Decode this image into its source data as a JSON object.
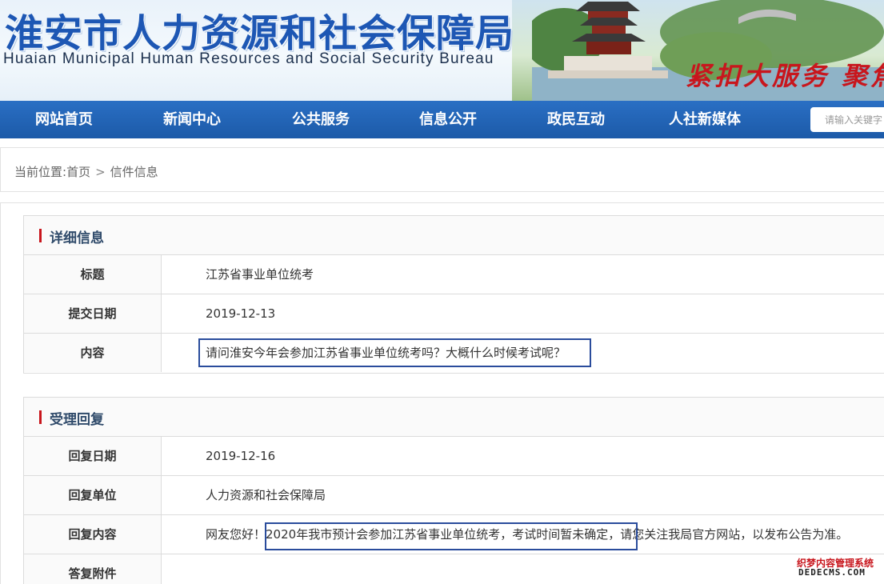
{
  "header": {
    "title_cn": "淮安市人力资源和社会保障局",
    "title_en": "Huaian Municipal Human Resources and Social Security Bureau",
    "slogan": "紧扣大服务  聚焦"
  },
  "nav": {
    "items": [
      "网站首页",
      "新闻中心",
      "公共服务",
      "信息公开",
      "政民互动",
      "人社新媒体"
    ],
    "search_placeholder": "请输入关键字"
  },
  "breadcrumb": {
    "prefix": "当前位置:",
    "home": "首页",
    "separator": ">",
    "current": "信件信息"
  },
  "detail": {
    "heading": "详细信息",
    "rows": [
      {
        "label": "标题",
        "value": "江苏省事业单位统考"
      },
      {
        "label": "提交日期",
        "value": "2019-12-13"
      },
      {
        "label": "内容",
        "value": "请问淮安今年会参加江苏省事业单位统考吗？大概什么时候考试呢？"
      }
    ]
  },
  "reply": {
    "heading": "受理回复",
    "rows": [
      {
        "label": "回复日期",
        "value": "2019-12-16"
      },
      {
        "label": "回复单位",
        "value": "人力资源和社会保障局"
      },
      {
        "label": "回复内容",
        "value_prefix": "网友您好！",
        "value_highlight": "2020年我市预计会参加江苏省事业单位统考，考试时间暂未确定",
        "value_suffix": "，请您关注我局官方网站，以发布公告为准。"
      },
      {
        "label": "答复附件",
        "value": ""
      }
    ]
  },
  "watermark": {
    "cn": "织梦内容管理系统",
    "en": "DEDECMS.COM"
  },
  "colors": {
    "brand_blue": "#1d57b4",
    "nav_blue": "#1c5aa8",
    "accent_red": "#c8161d",
    "highlight_border": "#2a4c9c"
  }
}
